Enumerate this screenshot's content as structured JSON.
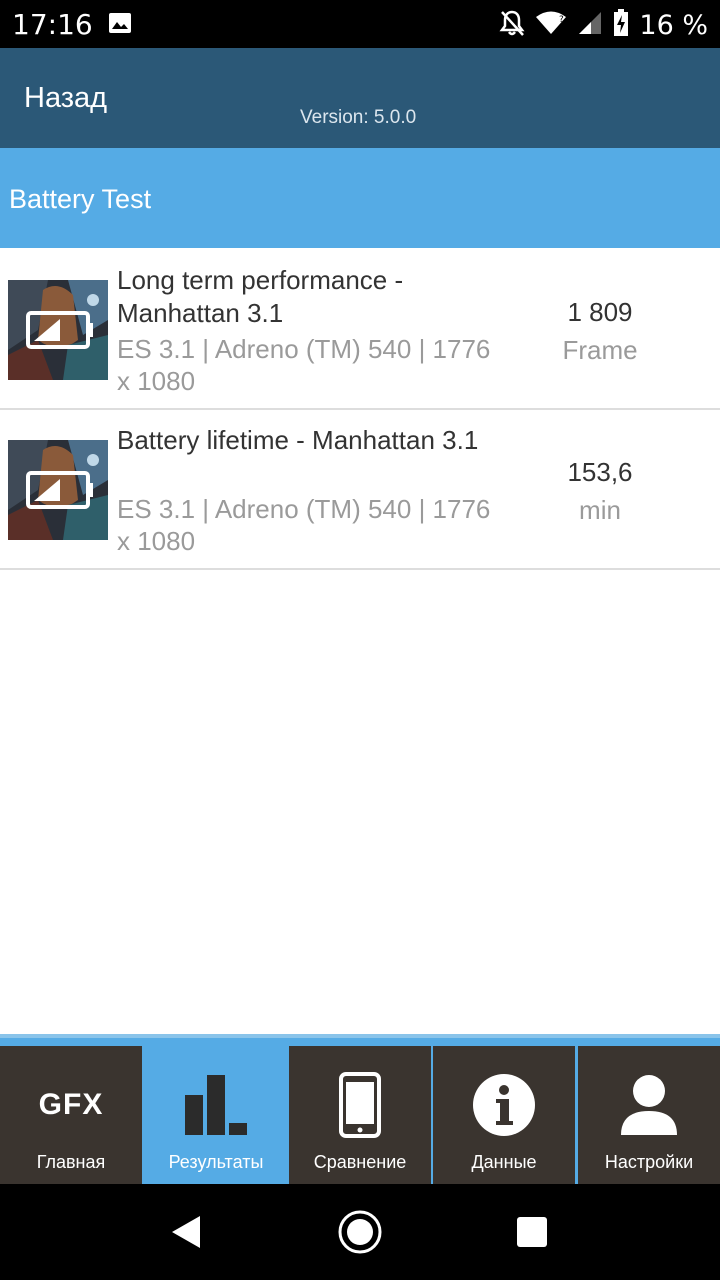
{
  "status_bar": {
    "time": "17:16",
    "battery_percent": "16 %"
  },
  "topbar": {
    "back_label": "Назад",
    "version": "Version: 5.0.0"
  },
  "section": {
    "title": "Battery Test"
  },
  "results": [
    {
      "name": "Long term performance - Manhattan 3.1",
      "details": "ES 3.1 | Adreno (TM) 540 | 1776 x 1080",
      "score": "1 809",
      "unit": "Frame"
    },
    {
      "name": "Battery lifetime - Manhattan 3.1",
      "details": "ES 3.1 | Adreno (TM) 540 | 1776 x 1080",
      "score": "153,6",
      "unit": "min"
    }
  ],
  "bottom_nav": {
    "items": [
      {
        "label": "Главная",
        "icon": "gfx-logo-icon"
      },
      {
        "label": "Результаты",
        "icon": "bar-chart-icon",
        "active": true
      },
      {
        "label": "Сравнение",
        "icon": "phone-icon"
      },
      {
        "label": "Данные",
        "icon": "info-icon"
      },
      {
        "label": "Настройки",
        "icon": "person-icon"
      }
    ],
    "gfx_text": "GFX"
  },
  "colors": {
    "topbar": "#2b5877",
    "accent": "#55abe5",
    "nav_bg": "#3a342f"
  }
}
